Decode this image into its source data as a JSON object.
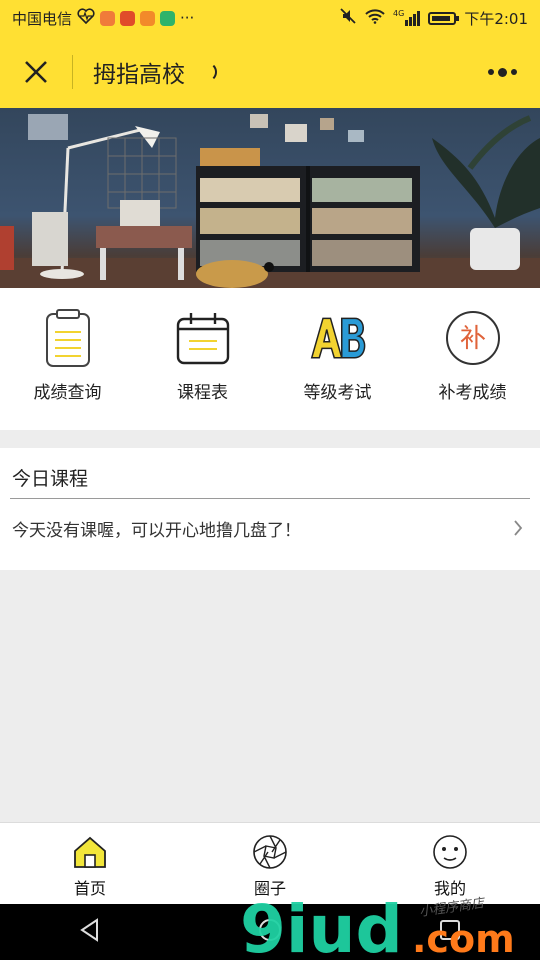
{
  "status_bar": {
    "carrier": "中国电信",
    "more": "···",
    "network": "4G",
    "time": "下午2:01"
  },
  "title_bar": {
    "title": "拇指高校"
  },
  "banner": {
    "image": "study room with bookshelves, lamp and plant",
    "active_index": 0
  },
  "quick_entries": [
    {
      "label": "成绩查询",
      "icon": "clipboard-icon"
    },
    {
      "label": "课程表",
      "icon": "calendar-icon"
    },
    {
      "label": "等级考试",
      "icon": "ab-icon"
    },
    {
      "label": "补考成绩",
      "icon": "bu-circle-icon",
      "icon_text": "补"
    }
  ],
  "today": {
    "title": "今日课程",
    "message": "今天没有课喔，可以开心地撸几盘了！"
  },
  "tab_bar": {
    "items": [
      {
        "label": "首页",
        "icon": "home-icon",
        "active": true
      },
      {
        "label": "圈子",
        "icon": "aperture-icon",
        "active": false
      },
      {
        "label": "我的",
        "icon": "smiley-icon",
        "active": false
      }
    ]
  },
  "watermark": {
    "text_main": "9iud",
    "text_suffix": ".com",
    "text_script": "小程序商店"
  },
  "colors": {
    "accent": "#ffe033",
    "watermark_green": "#1fd1a2",
    "watermark_orange": "#ff7a1a",
    "bu_red": "#e0633a"
  }
}
